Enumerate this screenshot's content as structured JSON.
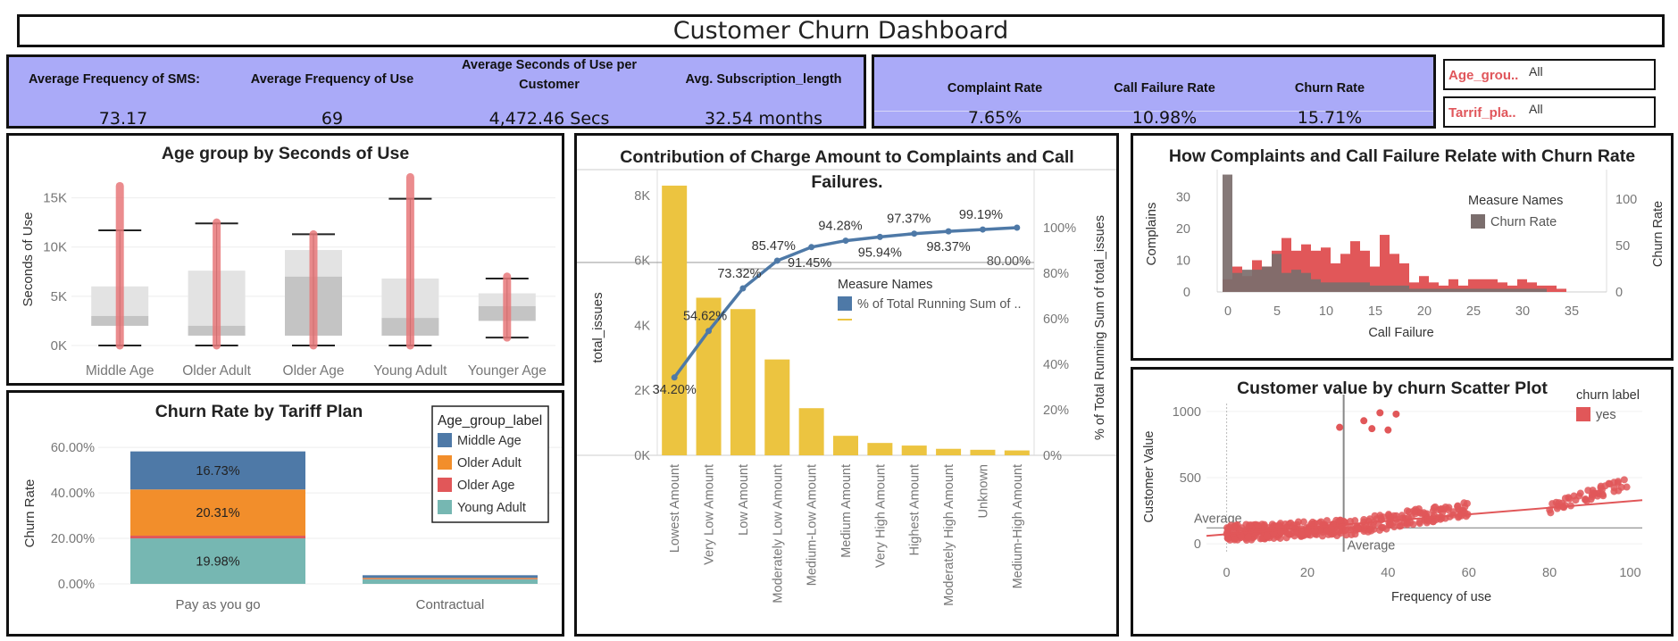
{
  "dashboard_title": "Customer Churn Dashboard",
  "kpis_left": [
    {
      "label": "Average Frequency of SMS:",
      "value": "73.17"
    },
    {
      "label": "Average Frequency of Use",
      "value": "69"
    },
    {
      "label": "Average Seconds of Use per Customer",
      "value": "4,472.46 Secs"
    },
    {
      "label": "Avg. Subscription_length",
      "value": "32.54 months"
    }
  ],
  "kpis_right": [
    {
      "label": "Complaint Rate",
      "value": "7.65%"
    },
    {
      "label": "Call Failure Rate",
      "value": "10.98%"
    },
    {
      "label": "Churn Rate",
      "value": "15.71%"
    }
  ],
  "filters": [
    {
      "label": "Age_grou..",
      "value": "All"
    },
    {
      "label": "Tarrif_pla..",
      "value": "All"
    }
  ],
  "colors": {
    "kpi_bg": "#aaaaf8",
    "blue": "#4e79a7",
    "orange": "#f28e2b",
    "red": "#e15759",
    "teal": "#76b7b2",
    "yellow": "#ecc440",
    "gray": "#7b6e6d",
    "line": "#4e79a7"
  },
  "chart_data": [
    {
      "id": "age_box",
      "type": "box",
      "title": "Age group by Seconds of Use",
      "ylabel": "Seconds of Use",
      "xlabel": "",
      "yticks": [
        "0K",
        "5K",
        "10K",
        "15K"
      ],
      "ylim": [
        0,
        17500
      ],
      "categories": [
        "Middle Age",
        "Older Adult",
        "Older Age",
        "Young Adult",
        "Younger Age"
      ],
      "boxes": [
        {
          "min": 0,
          "q1": 2000,
          "median": 3000,
          "q3": 6000,
          "whisker_high": 11700,
          "outliers_max": 16200
        },
        {
          "min": 0,
          "q1": 1000,
          "median": 2000,
          "q3": 7600,
          "whisker_high": 12400,
          "outliers_max": 12500
        },
        {
          "min": 0,
          "q1": 1000,
          "median": 7000,
          "q3": 9700,
          "whisker_high": 11300,
          "outliers_max": 11300
        },
        {
          "min": 0,
          "q1": 1000,
          "median": 2800,
          "q3": 6800,
          "whisker_high": 14900,
          "outliers_max": 17100
        },
        {
          "min": 800,
          "q1": 2500,
          "median": 4000,
          "q3": 5300,
          "whisker_high": 6800,
          "outliers_max": 7000
        }
      ]
    },
    {
      "id": "tariff_churn",
      "type": "bar",
      "stacked": true,
      "title": "Churn Rate by Tariff Plan",
      "ylabel": "Churn Rate",
      "yticks": [
        "0.00%",
        "20.00%",
        "40.00%",
        "60.00%"
      ],
      "ylim": [
        0,
        0.62
      ],
      "categories": [
        "Pay as you go",
        "Contractual"
      ],
      "legend_title": "Age_group_label",
      "series": [
        {
          "name": "Young Adult",
          "values": [
            0.1998,
            0.02
          ],
          "label": "19.98%"
        },
        {
          "name": "Older Age",
          "values": [
            0.012,
            0.002
          ],
          "label": ""
        },
        {
          "name": "Older Adult",
          "values": [
            0.2031,
            0.004
          ],
          "label": "20.31%"
        },
        {
          "name": "Middle Age",
          "values": [
            0.1673,
            0.012
          ],
          "label": "16.73%"
        }
      ],
      "legend": [
        "Middle Age",
        "Older Adult",
        "Older Age",
        "Young Adult"
      ]
    },
    {
      "id": "pareto",
      "type": "bar",
      "title": "Contribution of Charge Amount to Complaints and Call Failures.",
      "ylabel": "total_issues",
      "y2label": "% of Total Running Sum of total_issues",
      "yticks": [
        "0K",
        "2K",
        "4K",
        "6K",
        "8K"
      ],
      "y2ticks": [
        "0%",
        "20%",
        "40%",
        "60%",
        "80%",
        "100%"
      ],
      "ylim": [
        0,
        8600
      ],
      "categories": [
        "Lowest Amount",
        "Very Low Amount",
        "Low Amount",
        "Moderately Low Amount",
        "Medium-Low Amount",
        "Medium Amount",
        "Very High Amount",
        "Highest Amount",
        "Moderately High Amount",
        "Unknown",
        "Medium-High Amount"
      ],
      "values": [
        8300,
        4850,
        4500,
        2950,
        1450,
        600,
        380,
        300,
        200,
        170,
        150
      ],
      "line_values": [
        34.2,
        54.62,
        73.32,
        85.47,
        91.45,
        94.28,
        95.94,
        97.37,
        98.37,
        99.19,
        100.0
      ],
      "line_labels": [
        "34.20%",
        "54.62%",
        "73.32%",
        "85.47%",
        "91.45%",
        "94.28%",
        "95.94%",
        "97.37%",
        "98.37%",
        "99.19%",
        ""
      ],
      "reference_line": {
        "value": 80,
        "label": "80.00%"
      },
      "legend_title": "Measure Names",
      "legend": [
        "% of Total Running Sum of ..",
        ""
      ]
    },
    {
      "id": "complaints_failure",
      "type": "bar",
      "title": "How Complaints and Call Failure Relate with Churn Rate",
      "xlabel": "Call  Failure",
      "ylabel": "Complains",
      "y2label": "Churn Rate",
      "xticks": [
        "0",
        "5",
        "10",
        "15",
        "20",
        "25",
        "30",
        "35"
      ],
      "yticks": [
        "0",
        "10",
        "20",
        "30"
      ],
      "y2ticks": [
        "0",
        "50",
        "100"
      ],
      "legend_title": "Measure Names",
      "legend": [
        "Churn Rate"
      ],
      "x": [
        0,
        1,
        2,
        3,
        4,
        5,
        6,
        7,
        8,
        9,
        10,
        11,
        12,
        13,
        14,
        15,
        16,
        17,
        18,
        19,
        20,
        21,
        22,
        23,
        24,
        25,
        26,
        27,
        28,
        29,
        30,
        31,
        32,
        33,
        34
      ],
      "complaints": [
        4,
        8,
        5,
        10,
        8,
        13,
        17,
        13,
        15,
        13,
        14,
        9,
        12,
        16,
        13,
        8,
        18,
        12,
        9,
        3,
        5,
        3,
        2,
        4,
        2,
        4,
        4,
        4,
        3,
        2,
        4,
        3,
        2,
        2,
        1
      ],
      "churn": [
        37,
        6,
        7,
        7,
        8,
        12,
        6,
        7,
        6,
        4,
        3,
        3,
        3,
        3,
        3,
        2,
        2,
        2,
        2,
        1,
        1,
        1,
        1,
        1,
        1,
        1,
        1,
        1,
        1,
        1,
        1,
        1,
        1,
        0,
        0
      ]
    },
    {
      "id": "value_scatter",
      "type": "scatter",
      "title": "Customer value by churn Scatter Plot",
      "xlabel": "Frequency of use",
      "ylabel": "Customer Value",
      "xticks": [
        "0",
        "20",
        "40",
        "60",
        "80",
        "100"
      ],
      "yticks": [
        "0",
        "500",
        "1000"
      ],
      "xlim": [
        -5,
        103
      ],
      "ylim": [
        -60,
        1060
      ],
      "legend_title": "churn label",
      "legend": [
        "yes"
      ],
      "reference_lines": [
        {
          "axis": "y",
          "value": 120,
          "label": "Average"
        },
        {
          "axis": "x",
          "value": 29,
          "label": "Average"
        }
      ],
      "outlier_points": [
        [
          28,
          880
        ],
        [
          34,
          930
        ],
        [
          38,
          990
        ],
        [
          40,
          860
        ],
        [
          42,
          980
        ],
        [
          36,
          870
        ]
      ]
    }
  ]
}
